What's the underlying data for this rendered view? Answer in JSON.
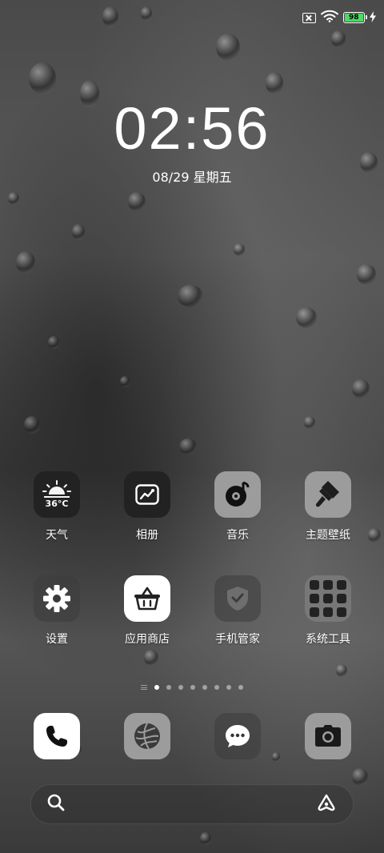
{
  "status_bar": {
    "icons": [
      "no-sim-icon",
      "wifi-icon",
      "battery-icon",
      "charging-bolt-icon"
    ],
    "battery_percent": "98",
    "battery_level": 0.98,
    "battery_color": "#4cd964"
  },
  "lock": {
    "time": "02:56",
    "date": "08/29 星期五"
  },
  "apps_row1": [
    {
      "label": "天气",
      "icon": "weather-icon",
      "temp": "36°C"
    },
    {
      "label": "相册",
      "icon": "gallery-icon"
    },
    {
      "label": "音乐",
      "icon": "music-icon"
    },
    {
      "label": "主题壁纸",
      "icon": "theme-brush-icon"
    }
  ],
  "apps_row2": [
    {
      "label": "设置",
      "icon": "settings-gear-icon"
    },
    {
      "label": "应用商店",
      "icon": "app-store-basket-icon"
    },
    {
      "label": "手机管家",
      "icon": "security-shield-icon"
    },
    {
      "label": "系统工具",
      "icon": "system-tools-folder-icon"
    }
  ],
  "page_indicator": {
    "pages": 8,
    "current": 1
  },
  "dock": [
    {
      "icon": "phone-icon"
    },
    {
      "icon": "browser-globe-icon"
    },
    {
      "icon": "messages-icon"
    },
    {
      "icon": "camera-icon"
    }
  ],
  "search_bar": {
    "left_icon": "search-icon",
    "right_icon": "assistant-icon"
  }
}
